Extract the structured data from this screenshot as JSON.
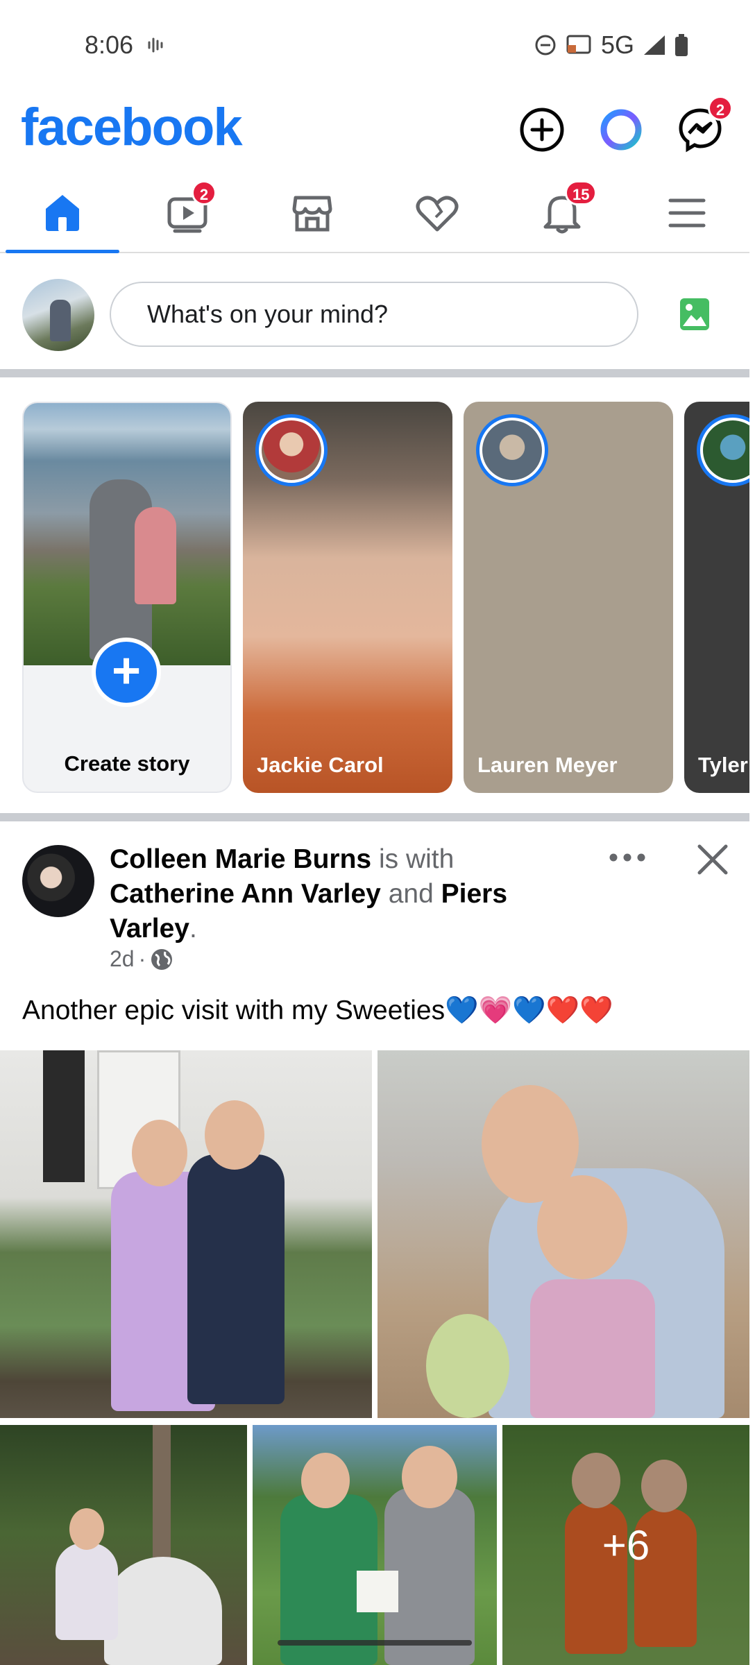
{
  "status": {
    "time": "8:06",
    "network": "5G"
  },
  "header": {
    "logo": "facebook",
    "messenger_badge": "2"
  },
  "tabs": [
    {
      "id": "home",
      "badge": ""
    },
    {
      "id": "video",
      "badge": "2"
    },
    {
      "id": "marketplace",
      "badge": ""
    },
    {
      "id": "dating",
      "badge": ""
    },
    {
      "id": "notifications",
      "badge": "15"
    },
    {
      "id": "menu",
      "badge": ""
    }
  ],
  "composer": {
    "placeholder": "What's on your mind?"
  },
  "stories": [
    {
      "name": "Create story"
    },
    {
      "name": "Jackie Carol"
    },
    {
      "name": "Lauren Meyer"
    },
    {
      "name": "Tyler"
    }
  ],
  "post": {
    "author": "Colleen Marie Burns",
    "with_text": "is with",
    "tagged_1": "Catherine Ann Varley",
    "and_text": "and",
    "tagged_2": "Piers Varley",
    "period": ".",
    "time": "2d",
    "separator": "·",
    "text": "Another epic visit with my Sweeties💙💗💙❤️❤️",
    "more_photos": "+6"
  },
  "colors": {
    "brand": "#1877f2",
    "badge": "#e41e3f"
  }
}
